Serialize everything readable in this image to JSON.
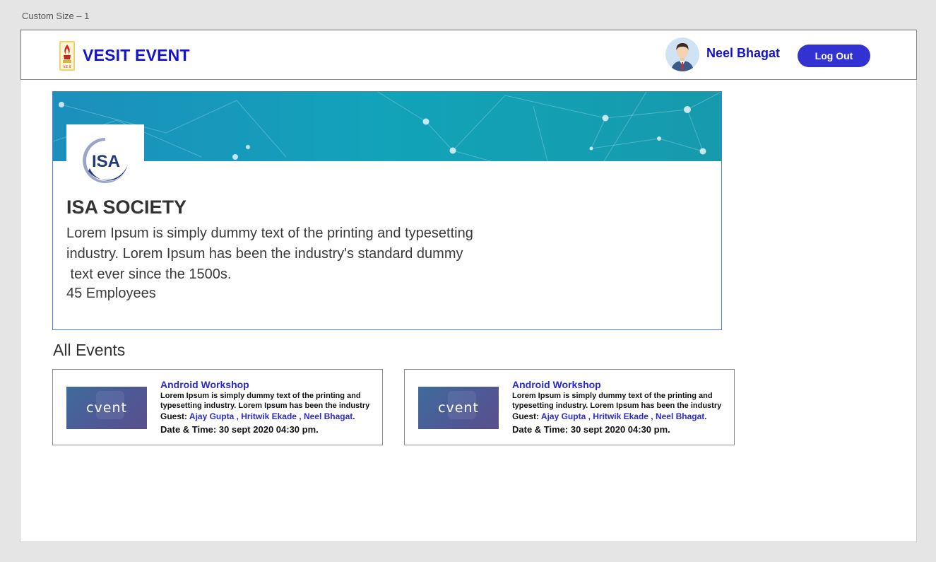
{
  "artboard": {
    "label": "Custom Size – 1"
  },
  "navbar": {
    "brand": "VESIT EVENT",
    "emblem_text": "V.E.S",
    "user_name": "Neel Bhagat",
    "logout_label": "Log Out",
    "brand_color": "#1212cf",
    "button_color": "#3232d2"
  },
  "society": {
    "logo_text": "ISA",
    "title": "ISA SOCIETY",
    "description_lines": [
      "Lorem Ipsum is simply dummy text of the printing and typesetting",
      "industry. Lorem Ipsum has been the industry's standard dummy",
      " text ever since the 1500s."
    ],
    "employees": "45 Employees"
  },
  "events_section": {
    "heading": "All Events"
  },
  "events": [
    {
      "thumb_text": "cvent",
      "title": "Android Workshop",
      "description": "Lorem Ipsum is simply dummy text of the printing and typesetting industry. Lorem Ipsum has been the industry",
      "guest_label": "Guest: ",
      "guests": "Ajay Gupta , Hritwik Ekade , Neel Bhagat.",
      "datetime": "Date & Time: 30 sept 2020  04:30 pm."
    },
    {
      "thumb_text": "cvent",
      "title": "Android Workshop",
      "description": "Lorem Ipsum is simply dummy text of the printing and typesetting industry. Lorem Ipsum has been the industry",
      "guest_label": "Guest: ",
      "guests": "Ajay Gupta , Hritwik Ekade , Neel Bhagat.",
      "datetime": "Date & Time: 30 sept 2020  04:30 pm."
    }
  ]
}
